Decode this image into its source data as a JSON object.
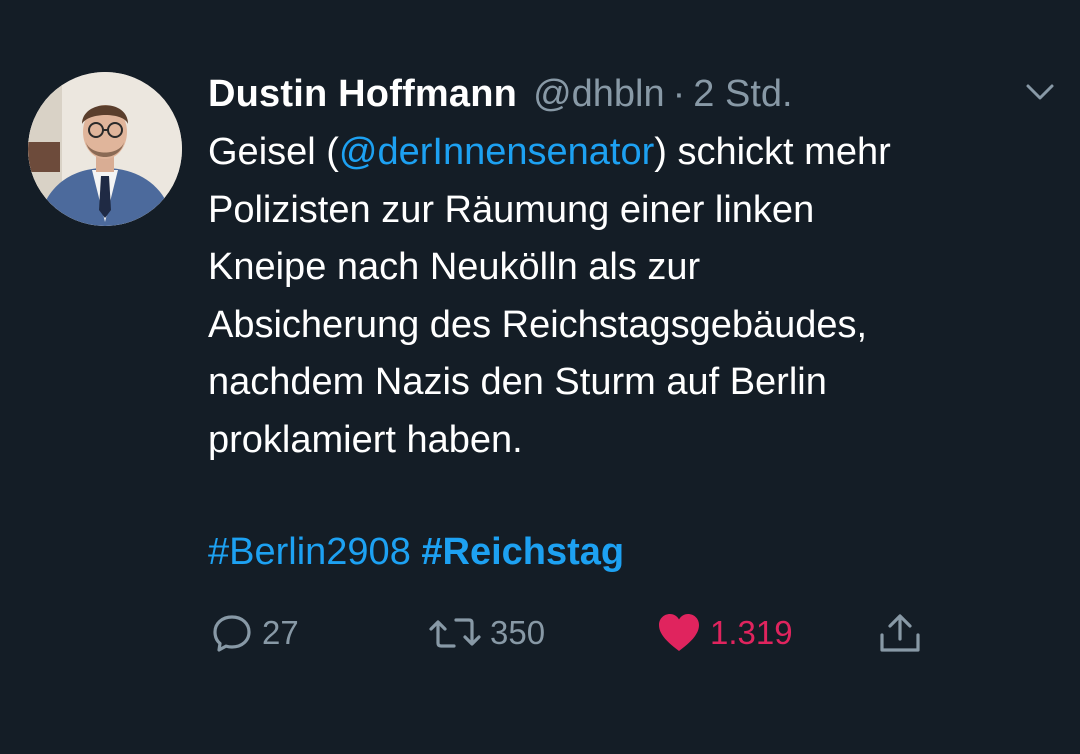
{
  "tweet": {
    "author": {
      "name": "Dustin Hoffmann",
      "handle": "@dhbln",
      "separator": "·",
      "time": "2 Std."
    },
    "text": {
      "line1_before": "Geisel (",
      "mention": "@derInnensenator",
      "line1_after": ") schickt mehr",
      "line2": "Polizisten zur Räumung einer linken",
      "line3": "Kneipe nach Neukölln als zur",
      "line4": "Absicherung des Reichstagsgebäudes,",
      "line5": "nachdem Nazis den Sturm auf Berlin",
      "line6": "proklamiert haben."
    },
    "hashtags": [
      "#Berlin2908",
      "#Reichstag"
    ],
    "actions": {
      "reply": {
        "icon": "reply-icon",
        "count": "27"
      },
      "retweet": {
        "icon": "retweet-icon",
        "count": "350"
      },
      "like": {
        "icon": "heart-icon",
        "count": "1.319",
        "liked": true
      },
      "share": {
        "icon": "share-icon"
      }
    },
    "menu_icon": "chevron-down-icon"
  },
  "colors": {
    "background": "#141d26",
    "text": "#ffffff",
    "secondary": "#8899a6",
    "link": "#1da1f2",
    "like": "#e0245e"
  }
}
